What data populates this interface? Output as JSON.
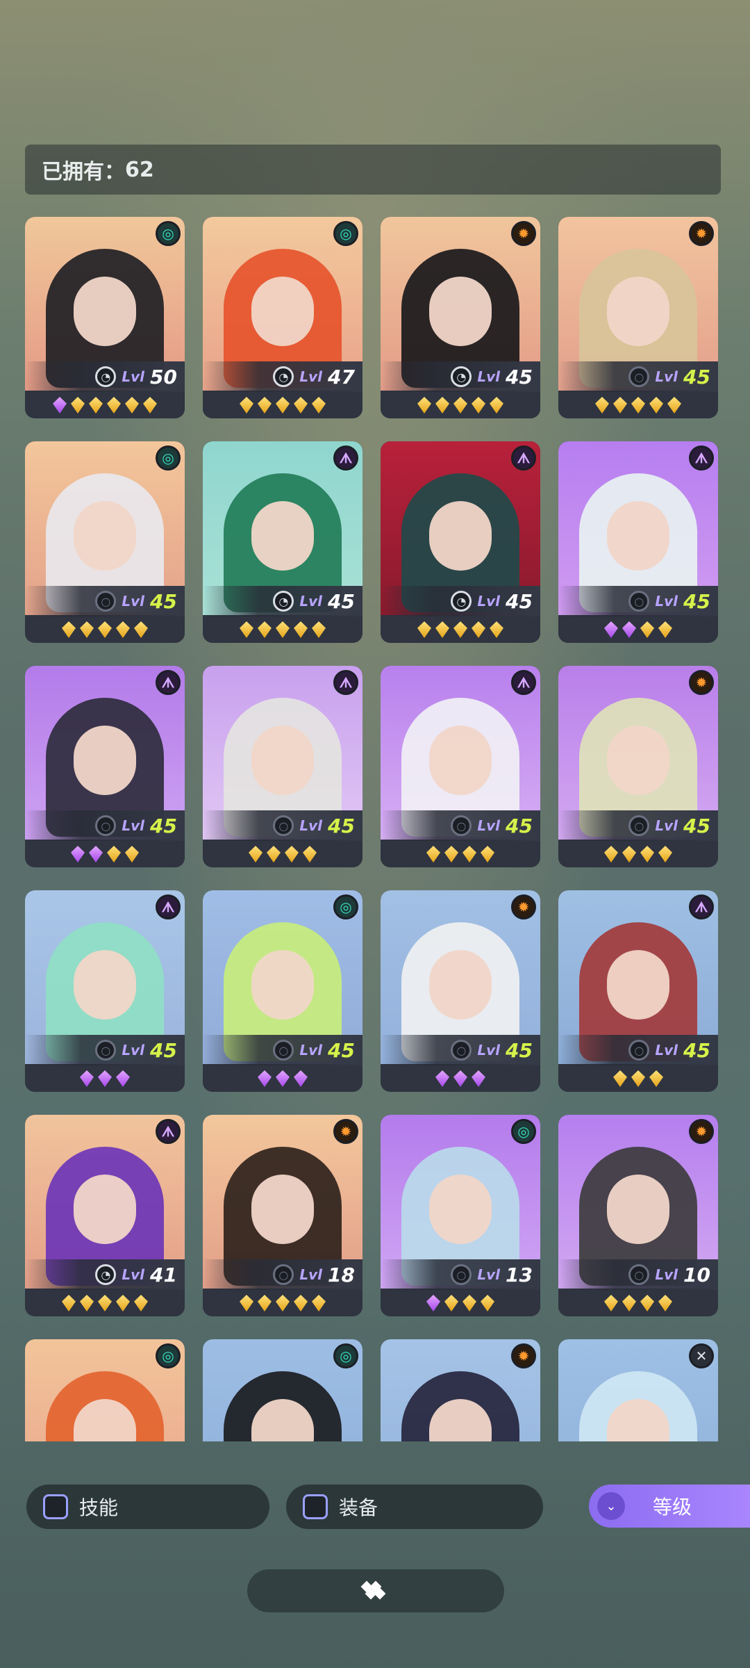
{
  "owned": {
    "label": "已拥有：",
    "count": "62"
  },
  "lvl_label": "Lvl",
  "cards": [
    {
      "faction": "teal",
      "bg": [
        "#f0c79a",
        "#e59a86"
      ],
      "hair": "#1c1d22",
      "level": "50",
      "gear": "full",
      "gems": [
        "purple",
        "gold",
        "gold",
        "gold",
        "gold",
        "gold"
      ]
    },
    {
      "faction": "teal",
      "bg": [
        "#f3c99d",
        "#e9a38a"
      ],
      "hair": "#e5522a",
      "level": "47",
      "gear": "half",
      "gems": [
        "gold",
        "gold",
        "gold",
        "gold",
        "gold"
      ]
    },
    {
      "faction": "orange",
      "bg": [
        "#f1c69c",
        "#e39c88"
      ],
      "hair": "#151518",
      "level": "45",
      "gear": "half",
      "gems": [
        "gold",
        "gold",
        "gold",
        "gold",
        "gold"
      ]
    },
    {
      "faction": "orange",
      "bg": [
        "#f2c49e",
        "#e3a08c"
      ],
      "hair": "#d8c49a",
      "level": "45",
      "gear": "dim",
      "gems": [
        "gold",
        "gold",
        "gold",
        "gold",
        "gold"
      ]
    },
    {
      "faction": "teal",
      "bg": [
        "#f3c69b",
        "#e4a28a"
      ],
      "hair": "#e9e9ee",
      "level": "45",
      "gear": "dim",
      "gems": [
        "gold",
        "gold",
        "gold",
        "gold",
        "gold"
      ]
    },
    {
      "faction": "purple",
      "bg": [
        "#8fd6cf",
        "#a9e1d6"
      ],
      "hair": "#1f7a55",
      "level": "45",
      "gear": "half",
      "gems": [
        "gold",
        "gold",
        "gold",
        "gold",
        "gold"
      ]
    },
    {
      "faction": "purple",
      "bg": [
        "#b8213a",
        "#8a1a2d"
      ],
      "hair": "#1e4a4a",
      "level": "45",
      "gear": "half",
      "gems": [
        "gold",
        "gold",
        "gold",
        "gold",
        "gold"
      ]
    },
    {
      "faction": "purple",
      "bg": [
        "#b67ef0",
        "#d09bf0"
      ],
      "hair": "#e9f4f2",
      "level": "45",
      "gear": "dim",
      "gems": [
        "purple",
        "purple",
        "gold",
        "gold"
      ]
    },
    {
      "faction": "purple",
      "bg": [
        "#b37be9",
        "#cda2f2"
      ],
      "hair": "#2b2a3a",
      "level": "45",
      "gear": "dim",
      "gems": [
        "purple",
        "purple",
        "gold",
        "gold"
      ]
    },
    {
      "faction": "purple",
      "bg": [
        "#c8a0ee",
        "#e1c7f4"
      ],
      "hair": "#e4e4e0",
      "level": "45",
      "gear": "dim",
      "gems": [
        "gold",
        "gold",
        "gold",
        "gold"
      ]
    },
    {
      "faction": "purple",
      "bg": [
        "#b880ed",
        "#d6aef3"
      ],
      "hair": "#f2f2f5",
      "level": "45",
      "gear": "dim",
      "gems": [
        "gold",
        "gold",
        "gold",
        "gold"
      ]
    },
    {
      "faction": "orange",
      "bg": [
        "#b97fea",
        "#d3a8f1"
      ],
      "hair": "#dfe3b8",
      "level": "45",
      "gear": "dim",
      "gems": [
        "gold",
        "gold",
        "gold",
        "gold"
      ]
    },
    {
      "faction": "purple",
      "bg": [
        "#a9c6e8",
        "#9cb4dc"
      ],
      "hair": "#8fe0c4",
      "level": "45",
      "gear": "dim",
      "gems": [
        "purple",
        "purple",
        "purple"
      ]
    },
    {
      "faction": "teal",
      "bg": [
        "#9fbde6",
        "#92acd8"
      ],
      "hair": "#c9ee7a",
      "level": "45",
      "gear": "dim",
      "gems": [
        "purple",
        "purple",
        "purple"
      ]
    },
    {
      "faction": "orange",
      "bg": [
        "#a2c0e4",
        "#93b1dc"
      ],
      "hair": "#f2f2f2",
      "level": "45",
      "gear": "dim",
      "gems": [
        "purple",
        "purple",
        "purple"
      ]
    },
    {
      "faction": "purple",
      "bg": [
        "#9fbfe3",
        "#8dadd8"
      ],
      "hair": "#a33838",
      "level": "45",
      "gear": "dim",
      "gems": [
        "gold",
        "gold",
        "gold"
      ]
    },
    {
      "faction": "purple",
      "bg": [
        "#f1c49c",
        "#e49f89"
      ],
      "hair": "#6a33b8",
      "level": "41",
      "gear": "half",
      "gems": [
        "gold",
        "gold",
        "gold",
        "gold",
        "gold"
      ]
    },
    {
      "faction": "orange",
      "bg": [
        "#f3c79c",
        "#e39f89"
      ],
      "hair": "#2a1f1a",
      "level": "18",
      "gear": "dim",
      "gems": [
        "gold",
        "gold",
        "gold",
        "gold",
        "gold"
      ]
    },
    {
      "faction": "teal",
      "bg": [
        "#b47bec",
        "#cfa6f3"
      ],
      "hair": "#b9dcea",
      "level": "13",
      "gear": "dim",
      "gems": [
        "purple",
        "gold",
        "gold",
        "gold"
      ]
    },
    {
      "faction": "orange",
      "bg": [
        "#b57fee",
        "#d2a7f2"
      ],
      "hair": "#3a3a3a",
      "level": "10",
      "gear": "dim",
      "gems": [
        "gold",
        "gold",
        "gold",
        "gold"
      ]
    },
    {
      "faction": "teal",
      "bg": [
        "#f2c49a",
        "#e9a58c"
      ],
      "hair": "#e2622c",
      "level": "",
      "gear": "none",
      "gems": []
    },
    {
      "faction": "teal",
      "bg": [
        "#9dbde4",
        "#8eb0da"
      ],
      "hair": "#17181c",
      "level": "",
      "gear": "none",
      "gems": []
    },
    {
      "faction": "orange",
      "bg": [
        "#a5c3e6",
        "#93b3dc"
      ],
      "hair": "#24213a",
      "level": "",
      "gear": "none",
      "gems": []
    },
    {
      "faction": "silver",
      "bg": [
        "#9ec0e5",
        "#8fb0d9"
      ],
      "hair": "#cfe8f5",
      "level": "",
      "gear": "none",
      "gems": []
    }
  ],
  "filters": {
    "skill": "技能",
    "equip": "装备",
    "level_sort": "等级"
  },
  "icons": {
    "faction_teal": "spiral-icon",
    "faction_orange": "gear-emblem-icon",
    "faction_purple": "crown-icon",
    "faction_silver": "cross-icon"
  }
}
